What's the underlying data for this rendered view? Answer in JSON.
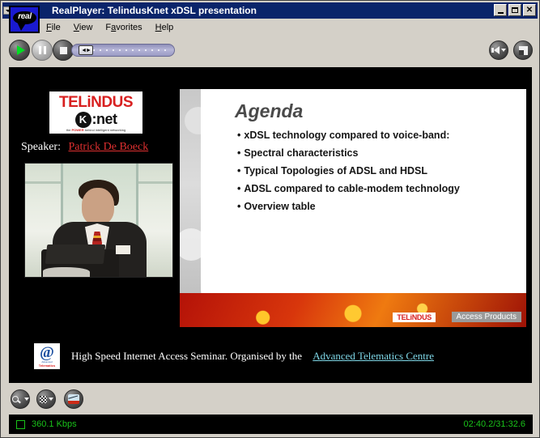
{
  "window": {
    "title": "RealPlayer: TelindusKnet xDSL presentation",
    "logo_text": "real",
    "sysmenu_icon": "system-menu-icon",
    "buttons": {
      "minimize": "minimize-icon",
      "maximize": "maximize-icon",
      "close": "close-icon"
    }
  },
  "menu": {
    "items": [
      {
        "label": "File",
        "accel": "F",
        "rest": "ile"
      },
      {
        "label": "View",
        "accel": "V",
        "rest": "iew"
      },
      {
        "label": "Favorites",
        "pre": "F",
        "accel": "a",
        "rest": "vorites"
      },
      {
        "label": "Help",
        "accel": "H",
        "rest": "elp"
      }
    ]
  },
  "toolbar": {
    "play": "play-button",
    "pause": "pause-button",
    "stop": "stop-button",
    "seek": "position-slider",
    "seek_arrows": "◄►",
    "volume": "volume-button",
    "panel_toggle": "panel-toggle-button"
  },
  "slide": {
    "title": "Agenda",
    "bullets": [
      "xDSL technology compared to voice-band:",
      "Spectral characteristics",
      "Typical Topologies of ADSL and HDSL",
      "ADSL compared to cable-modem technology",
      "Overview table"
    ],
    "bullet_char": "•",
    "banner": {
      "brand": "TELiNDUS",
      "product": "Access Products"
    }
  },
  "presenter": {
    "logo": {
      "top": "TELiNDUS",
      "circle": "K",
      "net": ":net",
      "tagline_pre": "the ",
      "tagline_red": "POWER",
      "tagline_post": " behind intelligent networking"
    },
    "speaker_label": "Speaker:",
    "speaker_name": "Patrick De Boeck",
    "video_thumbnail": "speaker-video-thumbnail"
  },
  "caption": {
    "logo_at": "@",
    "logo_line1": "Advanced",
    "logo_line2": "Telematics",
    "text": "High Speed Internet Access Seminar.  Organised by the",
    "link": "Advanced Telematics Centre"
  },
  "lower_toolbar": {
    "zoom": "zoom-button",
    "quality": "quality-button",
    "stats": "statistics-button"
  },
  "status": {
    "indicator": "stream-indicator",
    "bitrate": "360.1 Kbps",
    "time": "02:40.2/31:32.6"
  },
  "colors": {
    "titlebar": "#000080",
    "chrome": "#d4d0c8",
    "status_green": "#19c219",
    "brand_red": "#d82020",
    "link_cyan": "#7fd8e8",
    "speaker_red": "#e03030"
  }
}
